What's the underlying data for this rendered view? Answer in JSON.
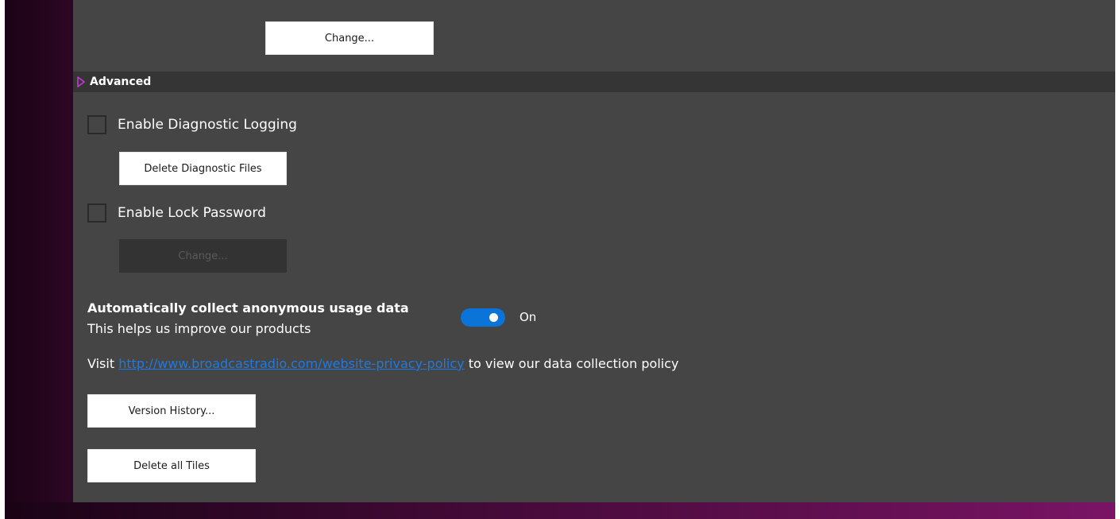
{
  "top": {
    "change_button_label": "Change..."
  },
  "advanced": {
    "title": "Advanced",
    "enable_diagnostic_logging_label": "Enable Diagnostic Logging",
    "enable_diagnostic_logging_checked": false,
    "delete_diagnostic_files_label": "Delete Diagnostic Files",
    "enable_lock_password_label": "Enable Lock Password",
    "enable_lock_password_checked": false,
    "lock_change_button_label": "Change..."
  },
  "usage": {
    "title": "Automatically collect anonymous usage data",
    "subtitle": "This helps us improve our products",
    "toggle_state_label": "On",
    "toggle_on": true
  },
  "privacy": {
    "prefix": "Visit ",
    "link_text": "http://www.broadcastradio.com/website-privacy-policy",
    "suffix": " to view our data collection policy"
  },
  "actions": {
    "version_history_label": "Version History...",
    "delete_all_tiles_label": "Delete all Tiles"
  },
  "colors": {
    "panel_bg": "#454545",
    "header_bg": "#353535",
    "accent_toggle": "#0a74d8",
    "link": "#1e7ae0",
    "chevron": "#c23bd4"
  },
  "icons": {
    "section_expander": "chevron-right-icon"
  }
}
